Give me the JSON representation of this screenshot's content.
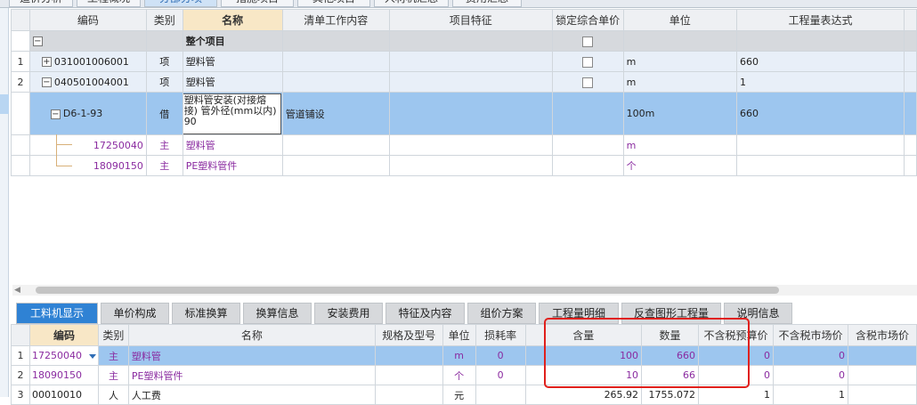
{
  "top_tabs": [
    "造价分析",
    "工程概况",
    "分部分项",
    "措施项目",
    "其他项目",
    "人材机汇总",
    "费用汇总"
  ],
  "upper": {
    "headers": {
      "code": "编码",
      "type": "类别",
      "name": "名称",
      "content": "清单工作内容",
      "feature": "项目特征",
      "lock": "锁定综合单价",
      "unit": "单位",
      "expr": "工程量表达式"
    },
    "rows": [
      {
        "num": "",
        "code": "",
        "type": "",
        "name": "整个项目",
        "content": "",
        "unit": "",
        "expr": ""
      },
      {
        "num": "1",
        "code": "031001006001",
        "type": "项",
        "name": "塑料管",
        "content": "",
        "unit": "m",
        "expr": "660"
      },
      {
        "num": "2",
        "code": "040501004001",
        "type": "项",
        "name": "塑料管",
        "content": "",
        "unit": "m",
        "expr": "1"
      },
      {
        "num": "",
        "code": "D6-1-93",
        "type": "借",
        "name": "塑料管安装(对接熔接) 管外径(mm以内) 90",
        "content": "管道铺设",
        "unit": "100m",
        "expr": "660"
      },
      {
        "num": "",
        "code": "17250040",
        "type": "主",
        "name": "塑料管",
        "content": "",
        "unit": "m",
        "expr": ""
      },
      {
        "num": "",
        "code": "18090150",
        "type": "主",
        "name": "PE塑料管件",
        "content": "",
        "unit": "个",
        "expr": ""
      }
    ]
  },
  "bottom_tabs": [
    "工料机显示",
    "单价构成",
    "标准换算",
    "换算信息",
    "安装费用",
    "特征及内容",
    "组价方案",
    "工程量明细",
    "反查图形工程量",
    "说明信息"
  ],
  "lower": {
    "headers": {
      "code": "编码",
      "type": "类别",
      "name": "名称",
      "spec": "规格及型号",
      "unit": "单位",
      "loss": "损耗率",
      "content": "含量",
      "qty": "数量",
      "budget": "不含税预算价",
      "market": "不含税市场价",
      "taxmarket": "含税市场价"
    },
    "rows": [
      {
        "num": "1",
        "code": "17250040",
        "type": "主",
        "name": "塑料管",
        "unit": "m",
        "loss": "0",
        "content": "100",
        "qty": "660",
        "budget": "0",
        "market": "0"
      },
      {
        "num": "2",
        "code": "18090150",
        "type": "主",
        "name": "PE塑料管件",
        "unit": "个",
        "loss": "0",
        "content": "10",
        "qty": "66",
        "budget": "0",
        "market": "0"
      },
      {
        "num": "3",
        "code": "00010010",
        "type": "人",
        "name": "人工费",
        "unit": "元",
        "loss": "",
        "content": "265.92",
        "qty": "1755.072",
        "budget": "1",
        "market": "1"
      }
    ]
  },
  "colors": {
    "accent": "#2f82d4",
    "selected_row": "#9dc6ef",
    "highlight_box": "#e0201c",
    "material_text": "#8a2ba0"
  }
}
